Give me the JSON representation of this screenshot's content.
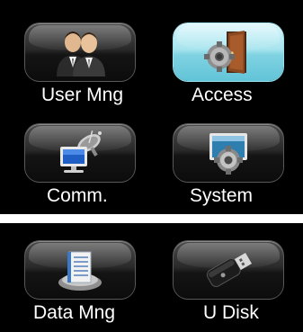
{
  "menu": {
    "items": [
      {
        "label": "User Mng",
        "icon": "users-icon",
        "selected": false
      },
      {
        "label": "Access",
        "icon": "door-gear-icon",
        "selected": true
      },
      {
        "label": "Comm.",
        "icon": "satellite-computer-icon",
        "selected": false
      },
      {
        "label": "System",
        "icon": "monitor-gear-icon",
        "selected": false
      },
      {
        "label": "Data Mng",
        "icon": "database-gear-icon",
        "selected": false
      },
      {
        "label": "U Disk",
        "icon": "usb-drive-icon",
        "selected": false
      }
    ]
  },
  "colors": {
    "background": "#000000",
    "selected_tile": "#8fd9e6",
    "label_text": "#ffffff"
  }
}
